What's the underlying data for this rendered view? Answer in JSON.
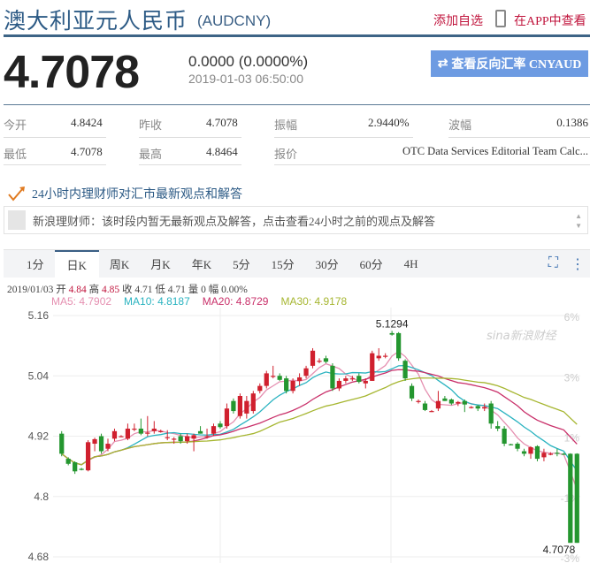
{
  "header": {
    "title": "澳大利亚元人民币",
    "code": "(AUDCNY)",
    "add_watch": "添加自选",
    "view_in_app": "在APP中查看"
  },
  "quote": {
    "price": "4.7078",
    "change": "0.0000 (0.0000%)",
    "time": "2019-01-03 06:50:00",
    "reverse_button": "查看反向汇率 CNYAUD",
    "reverse_icon": "⇄"
  },
  "stats": [
    {
      "label": "今开",
      "value": "4.8424"
    },
    {
      "label": "昨收",
      "value": "4.7078"
    },
    {
      "label": "振幅",
      "value": "2.9440%"
    },
    {
      "label": "波幅",
      "value": "0.1386"
    },
    {
      "label": "最低",
      "value": "4.7078"
    },
    {
      "label": "最高",
      "value": "4.8464"
    },
    {
      "label": "报价",
      "value": "OTC Data Services Editorial Team Calc..."
    }
  ],
  "advisor": {
    "heading": "24小时内理财师对汇市最新观点和解答",
    "message": "新浪理财师：该时段内暂无最新观点及解答，点击查看24小时之前的观点及解答"
  },
  "tabs": [
    "1分",
    "日K",
    "周K",
    "月K",
    "年K",
    "5分",
    "15分",
    "30分",
    "60分",
    "4H"
  ],
  "active_tab": "日K",
  "info": {
    "date": "2019/01/03",
    "open_label": "开",
    "open": "4.84",
    "high_label": "高",
    "high": "4.85",
    "close_label": "收",
    "close": "4.71",
    "low_label": "低",
    "low": "4.71",
    "vol_label": "量",
    "vol": "0",
    "amp_label": "幅",
    "amp": "0.00%"
  },
  "ma": [
    {
      "label": "MA5: 4.7902",
      "color": "#e58fb0"
    },
    {
      "label": "MA10: 4.8187",
      "color": "#2ab3c0"
    },
    {
      "label": "MA20: 4.8729",
      "color": "#c9306a"
    },
    {
      "label": "MA30: 4.9178",
      "color": "#a6b630"
    }
  ],
  "watermark": "sina新浪财经",
  "chart_data": {
    "type": "candlestick",
    "y_ticks": [
      "5.16",
      "5.04",
      "4.92",
      "4.8",
      "4.68"
    ],
    "y_tick_values": [
      5.16,
      5.04,
      4.92,
      4.8,
      4.68
    ],
    "pct_ticks": [
      "6%",
      "3%",
      "1%",
      "-1%",
      "-3%"
    ],
    "ylim": [
      4.68,
      5.17
    ],
    "max_label": "5.1294",
    "min_label": "4.7078",
    "up_color": "#d0202e",
    "down_color": "#24962f",
    "ohlc": [
      [
        4.925,
        4.93,
        4.88,
        4.885
      ],
      [
        4.875,
        4.878,
        4.862,
        4.865
      ],
      [
        4.868,
        4.87,
        4.845,
        4.85
      ],
      [
        4.855,
        4.857,
        4.852,
        4.853
      ],
      [
        4.852,
        4.912,
        4.85,
        4.908
      ],
      [
        4.905,
        4.917,
        4.89,
        4.914
      ],
      [
        4.92,
        4.925,
        4.885,
        4.89
      ],
      [
        4.895,
        4.915,
        4.89,
        4.905
      ],
      [
        4.915,
        4.935,
        4.91,
        4.93
      ],
      [
        4.92,
        4.922,
        4.918,
        4.92
      ],
      [
        4.915,
        4.945,
        4.912,
        4.935
      ],
      [
        4.935,
        4.945,
        4.93,
        4.935
      ],
      [
        4.935,
        4.955,
        4.922,
        4.925
      ],
      [
        4.925,
        4.96,
        4.92,
        4.927
      ],
      [
        4.93,
        4.95,
        4.925,
        4.935
      ],
      [
        4.93,
        4.933,
        4.927,
        4.93
      ],
      [
        4.918,
        4.932,
        4.912,
        4.918
      ],
      [
        4.915,
        4.918,
        4.905,
        4.915
      ],
      [
        4.92,
        4.925,
        4.905,
        4.91
      ],
      [
        4.91,
        4.925,
        4.905,
        4.92
      ],
      [
        4.915,
        4.925,
        4.89,
        4.922
      ],
      [
        4.93,
        4.94,
        4.925,
        4.925
      ],
      [
        4.918,
        4.935,
        4.915,
        4.92
      ],
      [
        4.925,
        4.945,
        4.92,
        4.94
      ],
      [
        4.945,
        4.95,
        4.935,
        4.938
      ],
      [
        4.94,
        4.985,
        4.935,
        4.975
      ],
      [
        4.99,
        4.995,
        4.965,
        4.97
      ],
      [
        4.96,
        5.005,
        4.955,
        5.0
      ],
      [
        4.965,
        5.0,
        4.955,
        4.99
      ],
      [
        4.97,
        5.01,
        4.965,
        5.005
      ],
      [
        5.01,
        5.025,
        5.005,
        5.02
      ],
      [
        5.02,
        5.05,
        5.015,
        5.045
      ],
      [
        5.04,
        5.06,
        5.035,
        5.04
      ],
      [
        5.04,
        5.045,
        5.03,
        5.032
      ],
      [
        5.035,
        5.04,
        5.005,
        5.01
      ],
      [
        5.01,
        5.035,
        5.005,
        5.03
      ],
      [
        5.03,
        5.045,
        5.02,
        5.037
      ],
      [
        5.04,
        5.06,
        5.035,
        5.055
      ],
      [
        5.06,
        5.095,
        5.055,
        5.09
      ],
      [
        5.07,
        5.075,
        5.065,
        5.07
      ],
      [
        5.075,
        5.08,
        5.065,
        5.068
      ],
      [
        5.06,
        5.065,
        5.01,
        5.015
      ],
      [
        5.015,
        5.035,
        5.01,
        5.03
      ],
      [
        5.03,
        5.04,
        5.025,
        5.035
      ],
      [
        5.035,
        5.04,
        5.03,
        5.035
      ],
      [
        5.04,
        5.045,
        5.025,
        5.028
      ],
      [
        5.025,
        5.035,
        5.015,
        5.03
      ],
      [
        5.03,
        5.09,
        5.03,
        5.085
      ],
      [
        5.075,
        5.095,
        5.07,
        5.08
      ],
      [
        5.08,
        5.085,
        5.075,
        5.08
      ],
      [
        5.125,
        5.1294,
        5.12,
        5.122
      ],
      [
        5.125,
        5.127,
        5.07,
        5.075
      ],
      [
        5.07,
        5.073,
        5.03,
        5.035
      ],
      [
        5.02,
        5.025,
        4.99,
        4.995
      ],
      [
        4.99,
        4.993,
        4.985,
        4.99
      ],
      [
        4.985,
        4.99,
        4.97,
        4.972
      ],
      [
        4.97,
        4.972,
        4.968,
        4.97
      ],
      [
        4.975,
        5.01,
        4.97,
        4.99
      ],
      [
        4.995,
        5.0,
        4.99,
        4.99
      ],
      [
        4.993,
        4.995,
        4.982,
        4.985
      ],
      [
        4.985,
        4.99,
        4.98,
        4.988
      ],
      [
        4.99,
        4.993,
        4.968,
        4.983
      ],
      [
        4.978,
        4.98,
        4.975,
        4.978
      ],
      [
        4.98,
        4.982,
        4.97,
        4.975
      ],
      [
        4.975,
        4.985,
        4.97,
        4.978
      ],
      [
        4.985,
        4.99,
        4.935,
        4.945
      ],
      [
        4.94,
        4.95,
        4.93,
        4.935
      ],
      [
        4.935,
        4.94,
        4.9,
        4.905
      ],
      [
        4.904,
        4.905,
        4.902,
        4.903
      ],
      [
        4.905,
        4.908,
        4.89,
        4.895
      ],
      [
        4.89,
        4.895,
        4.88,
        4.885
      ],
      [
        4.885,
        4.9,
        4.875,
        4.898
      ],
      [
        4.9,
        4.902,
        4.87,
        4.875
      ],
      [
        4.878,
        4.895,
        4.87,
        4.887
      ],
      [
        4.885,
        4.888,
        4.882,
        4.885
      ],
      [
        4.887,
        4.895,
        4.88,
        4.886
      ],
      [
        4.885,
        4.887,
        4.883,
        4.884
      ],
      [
        4.885,
        4.886,
        4.7078,
        4.7078
      ],
      [
        4.885,
        4.886,
        4.7078,
        4.7078
      ]
    ]
  }
}
